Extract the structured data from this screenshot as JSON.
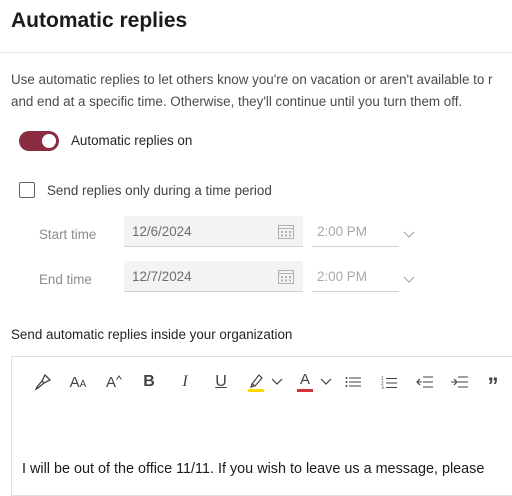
{
  "page": {
    "title": "Automatic replies"
  },
  "description": {
    "line1": "Use automatic replies to let others know you're on vacation or aren't available to r",
    "line2": "and end at a specific time. Otherwise, they'll continue until you turn them off."
  },
  "toggle": {
    "label": "Automatic replies on",
    "state": "on",
    "accent_color": "#8a2c42"
  },
  "time_period": {
    "label": "Send replies only during a time period",
    "checked": false
  },
  "schedule": {
    "start": {
      "label": "Start time",
      "date": "12/6/2024",
      "time": "2:00 PM"
    },
    "end": {
      "label": "End time",
      "date": "12/7/2024",
      "time": "2:00 PM"
    }
  },
  "inside_org": {
    "label": "Send automatic replies inside your organization"
  },
  "toolbar": {
    "items": [
      {
        "name": "format-painter-icon"
      },
      {
        "name": "font-size-icon",
        "text": "A",
        "small": "A"
      },
      {
        "name": "grow-font-icon",
        "text": "A"
      },
      {
        "name": "bold-button",
        "text": "B"
      },
      {
        "name": "italic-button",
        "text": "I"
      },
      {
        "name": "underline-button",
        "text": "U"
      },
      {
        "name": "highlight-icon",
        "color": "#ffd800"
      },
      {
        "name": "font-color-icon",
        "text": "A",
        "color": "#d13438"
      },
      {
        "name": "bullets-icon"
      },
      {
        "name": "numbering-icon"
      },
      {
        "name": "decrease-indent-icon"
      },
      {
        "name": "increase-indent-icon"
      },
      {
        "name": "quote-icon",
        "text": "”"
      }
    ]
  },
  "message": {
    "text": "I will be out of the office 11/11. If you wish to leave us a message, please"
  }
}
